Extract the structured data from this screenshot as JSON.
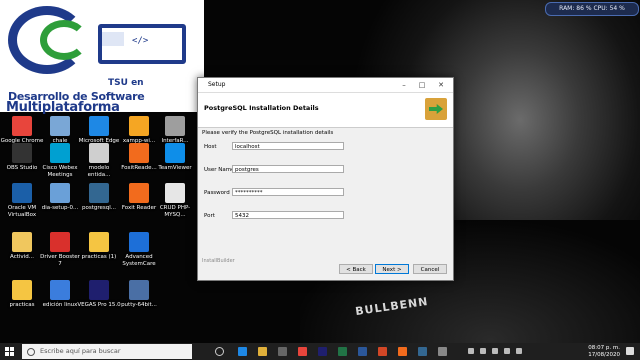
{
  "system_monitor": "RAM: 86 %  CPU: 54 %",
  "logo": {
    "code_glyph": "</>",
    "line1": "TSU en",
    "line2": "Desarrollo de Software",
    "line3": "Multiplataforma"
  },
  "desktop_icons": [
    {
      "label": "Google Chrome",
      "color": "#e8453c"
    },
    {
      "label": "chale",
      "color": "#7aa7d6"
    },
    {
      "label": "Microsoft Edge",
      "color": "#1e88e5"
    },
    {
      "label": "xampp-wi...",
      "color": "#f5a623"
    },
    {
      "label": "InterfaR...",
      "color": "#9e9e9e"
    },
    {
      "label": "OBS Studio",
      "color": "#333333"
    },
    {
      "label": "Cisco Webex Meetings",
      "color": "#00a0d1"
    },
    {
      "label": "modelo entida...",
      "color": "#cfcfcf"
    },
    {
      "label": "FoxitReade...",
      "color": "#f26b1d"
    },
    {
      "label": "TeamViewer",
      "color": "#0e8ee9"
    },
    {
      "label": "Oracle VM VirtualBox",
      "color": "#1b5fa8"
    },
    {
      "label": "dia-setup-0...",
      "color": "#6aa0d8"
    },
    {
      "label": "postgresql...",
      "color": "#336791"
    },
    {
      "label": "Foxit Reader",
      "color": "#f26b1d"
    },
    {
      "label": "CRUD PHP-MYSQ...",
      "color": "#e6e6e6"
    },
    {
      "label": "Activid...",
      "color": "#f0c75e"
    },
    {
      "label": "Driver Booster 7",
      "color": "#d9302c"
    },
    {
      "label": "practicas (1)",
      "color": "#f5c542"
    },
    {
      "label": "Advanced SystemCare",
      "color": "#1d6fd8"
    },
    {
      "label": "practicas",
      "color": "#f5c542"
    },
    {
      "label": "edición linux",
      "color": "#3b7ddd"
    },
    {
      "label": "VEGAS Pro 15.0",
      "color": "#1f1f6e"
    },
    {
      "label": "putty-64bit...",
      "color": "#4a6fa5"
    }
  ],
  "dialog": {
    "title": "Setup",
    "header": "PostgreSQL Installation Details",
    "verify_text": "Please verify the PostgreSQL installation details",
    "fields": [
      {
        "label": "Host",
        "value": "localhost"
      },
      {
        "label": "User Name",
        "value": "postgres"
      },
      {
        "label": "Password",
        "value": "**********"
      },
      {
        "label": "Port",
        "value": "5432"
      }
    ],
    "footer_text": "InstallBuilder",
    "buttons": {
      "back": "< Back",
      "next": "Next >",
      "cancel": "Cancel"
    }
  },
  "shirt_text": "BULLBENN",
  "taskbar": {
    "search_placeholder": "Escribe aquí para buscar",
    "time": "08:07 p. m.",
    "date": "17/08/2020"
  }
}
